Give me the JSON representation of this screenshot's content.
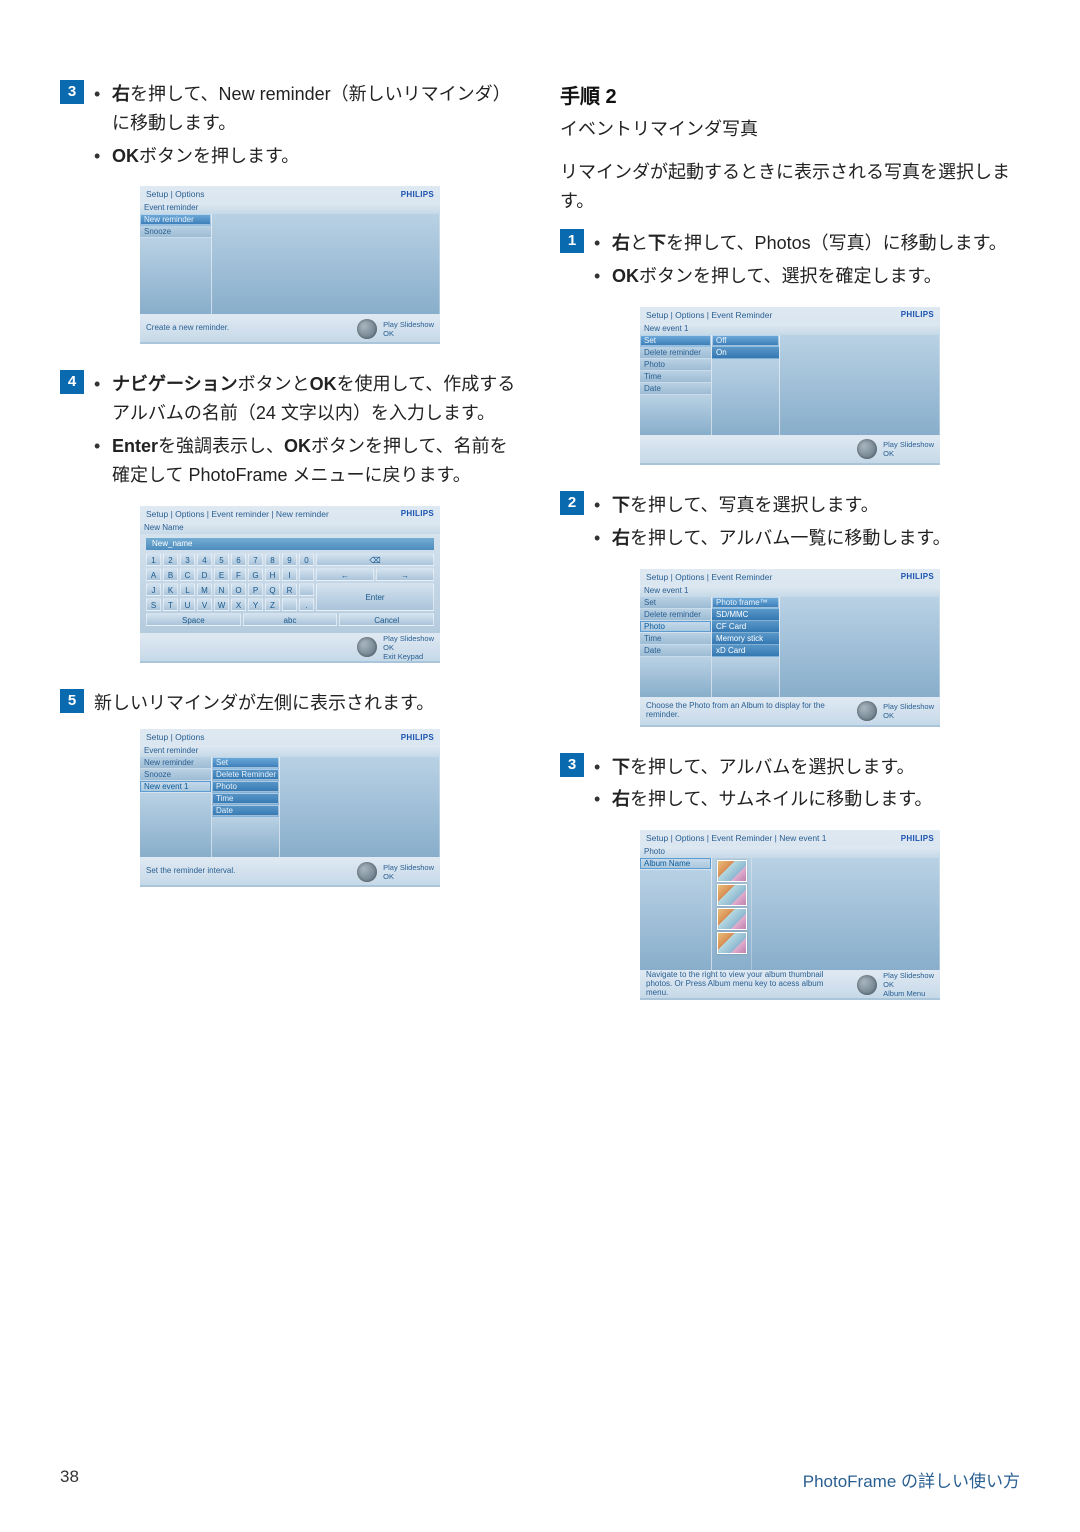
{
  "page": {
    "number": "38",
    "chapter": "PhotoFrame の詳しい使い方"
  },
  "step2_heading": "手順 2",
  "step2_subtitle": "イベントリマインダ写真",
  "step2_desc": "リマインダが起動するときに表示される写真を選択します。",
  "left": {
    "s3": {
      "l1": "右を押して、New reminder（新しいリマインダ）に移動します。",
      "l2": "OKボタンを押します。"
    },
    "s4": {
      "l1": "ナビゲーションボタンとOKを使用して、作成するアルバムの名前（24 文字以内）を入力します。",
      "l2": "Enterを強調表示し、OKボタンを押して、名前を確定して PhotoFrame メニューに戻ります。"
    },
    "s5": {
      "l1": "新しいリマインダが左側に表示されます。"
    }
  },
  "right": {
    "s1": {
      "l1": "右と下を押して、Photos（写真）に移動します。",
      "l2": "OKボタンを押して、選択を確定します。"
    },
    "s2": {
      "l1": "下を押して、写真を選択します。",
      "l2": "右を押して、アルバム一覧に移動します。"
    },
    "s3": {
      "l1": "下を押して、アルバムを選択します。",
      "l2": "右を押して、サムネイルに移動します。"
    }
  },
  "shots": {
    "brand": "PHILIPS",
    "A": {
      "breadcrumb": "Setup | Options",
      "header": "Event reminder",
      "items": [
        "New reminder",
        "Snooze"
      ],
      "footer": "Create a new reminder.",
      "legend": [
        "Play Slideshow",
        "OK"
      ]
    },
    "B": {
      "breadcrumb": "Setup | Options | Event reminder | New reminder",
      "header": "New Name",
      "kbd_title": "New_name",
      "rows": [
        [
          "1",
          "2",
          "3",
          "4",
          "5",
          "6",
          "7",
          "8",
          "9",
          "0"
        ],
        [
          "A",
          "B",
          "C",
          "D",
          "E",
          "F",
          "G",
          "H",
          "I",
          ""
        ],
        [
          "J",
          "K",
          "L",
          "M",
          "N",
          "O",
          "P",
          "Q",
          "R",
          ""
        ],
        [
          "S",
          "T",
          "U",
          "V",
          "W",
          "X",
          "Y",
          "Z",
          "",
          "."
        ]
      ],
      "side": {
        "backspace": "⌫",
        "left": "←",
        "right": "→",
        "enter": "Enter"
      },
      "bottom": [
        "Space",
        "abc",
        "Cancel"
      ],
      "legend": [
        "Play Slideshow",
        "OK",
        "Exit Keypad"
      ]
    },
    "C": {
      "breadcrumb": "Setup | Options",
      "header": "Event reminder",
      "col1": [
        "New reminder",
        "Snooze",
        "New event 1"
      ],
      "col2": [
        "Set",
        "Delete Reminder",
        "Photo",
        "Time",
        "Date"
      ],
      "footer": "Set the reminder interval.",
      "legend": [
        "Play Slideshow",
        "OK"
      ]
    },
    "D": {
      "breadcrumb": "Setup | Options | Event Reminder",
      "header": "New event 1",
      "col1": [
        "Set",
        "Delete reminder",
        "Photo",
        "Time",
        "Date"
      ],
      "col2": [
        "Off",
        "On"
      ],
      "legend": [
        "Play Slideshow",
        "OK"
      ]
    },
    "E": {
      "breadcrumb": "Setup | Options | Event Reminder",
      "header": "New event 1",
      "col1": [
        "Set",
        "Delete reminder",
        "Photo",
        "Time",
        "Date"
      ],
      "col2": [
        "Photo frame™",
        "SD/MMC",
        "CF Card",
        "Memory stick",
        "xD Card"
      ],
      "footer": "Choose the Photo from an Album to display for the reminder.",
      "legend": [
        "Play Slideshow",
        "OK"
      ]
    },
    "F": {
      "breadcrumb": "Setup | Options | Event Reminder | New event 1",
      "header": "Photo",
      "col1": [
        "Album Name"
      ],
      "footer": "Navigate to the right to view your album thumbnail photos. Or Press Album menu key to acess album menu.",
      "legend": [
        "Play Slideshow",
        "OK",
        "Album Menu"
      ]
    }
  }
}
